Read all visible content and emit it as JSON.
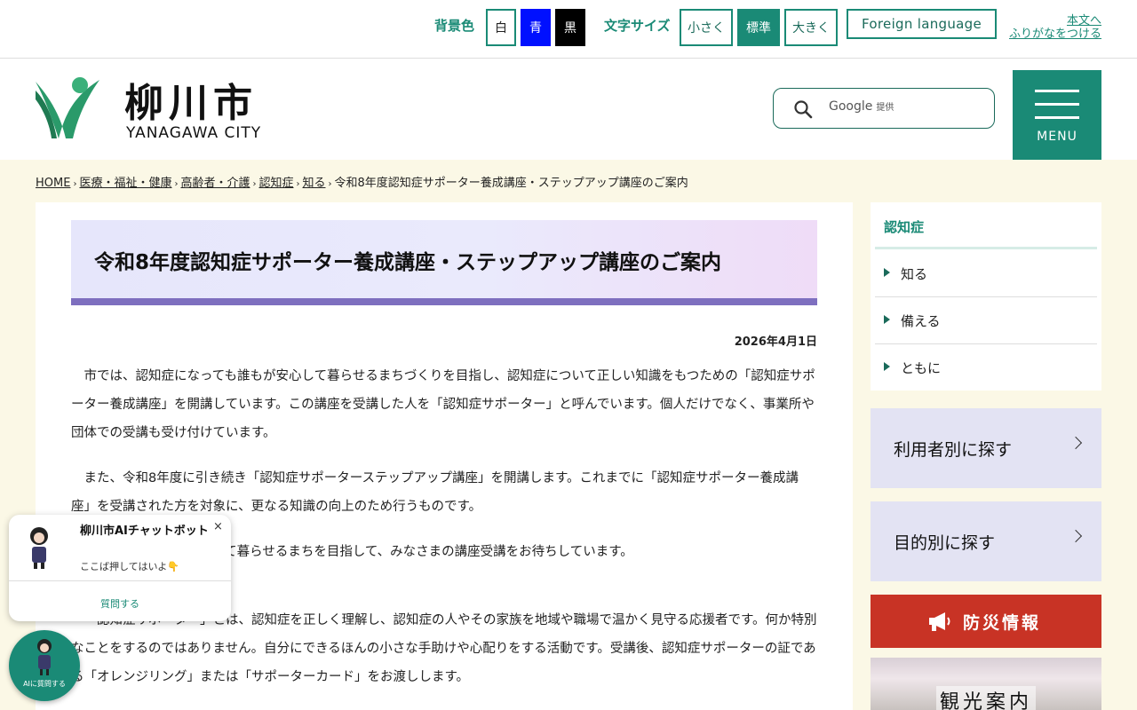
{
  "utility": {
    "bg_label": "背景色",
    "bg_white": "白",
    "bg_blue": "青",
    "bg_black": "黒",
    "font_label": "文字サイズ",
    "font_small": "小さく",
    "font_standard": "標準",
    "font_large": "大きく",
    "foreign": "Foreign language",
    "to_main": "本文へ",
    "furigana": "ふりがなをつける"
  },
  "header": {
    "logo_title": "柳川市",
    "logo_sub": "YANAGAWA CITY",
    "search_placeholder": "Google",
    "search_provider": "提供",
    "menu_label": "MENU"
  },
  "breadcrumb": {
    "items": [
      "HOME",
      "医療・福祉・健康",
      "高齢者・介護",
      "認知症",
      "知る"
    ],
    "current": "令和8年度認知症サポーター養成講座・ステップアップ講座のご案内",
    "separator": "›"
  },
  "article": {
    "title": "令和8年度認知症サポーター養成講座・ステップアップ講座のご案内",
    "date": "2026年4月1日",
    "paragraphs": [
      "市では、認知症になっても誰もが安心して暮らせるまちづくりを目指し、認知症について正しい知識をもつための「認知症サポーター養成講座」を開講しています。この講座を受講した人を「認知症サポーター」と呼んでいます。個人だけでなく、事業所や団体での受講も受け付けています。",
      "また、令和8年度に引き続き「認知症サポーターステップアップ講座」を開講します。これまでに「認知症サポーター養成講座」を受講された方を対象に、更なる知識の向上のため行うものです。",
      "認知症になっても安心して暮らせるまちを目指して、みなさまの講座受講をお待ちしています。",
      "「認知症サポーター」とは、認知症を正しく理解し、認知症の人やその家族を地域や職場で温かく見守る応援者です。何か特別なことをするのではありません。自分にできるほんの小さな手助けや心配りをする活動です。受講後、認知症サポーターの証である「オレンジリング」または「サポーターカード」をお渡しします。"
    ]
  },
  "sidebar": {
    "heading": "認知症",
    "items": [
      "知る",
      "備える",
      "ともに"
    ],
    "by_user": "利用者別に探す",
    "by_purpose": "目的別に探す",
    "disaster": "防災情報",
    "tourism": "観光案内"
  },
  "chat": {
    "title": "柳川市AIチャットボット",
    "subtitle": "ここば押してはいよ👇",
    "close": "×",
    "ask": "質問する",
    "fab_label": "AIに質問する"
  },
  "colors": {
    "brand_green": "#1a8a76",
    "title_bar": "#7e6fbf",
    "disaster_red": "#c83325",
    "page_bg": "#fbf8e6"
  }
}
